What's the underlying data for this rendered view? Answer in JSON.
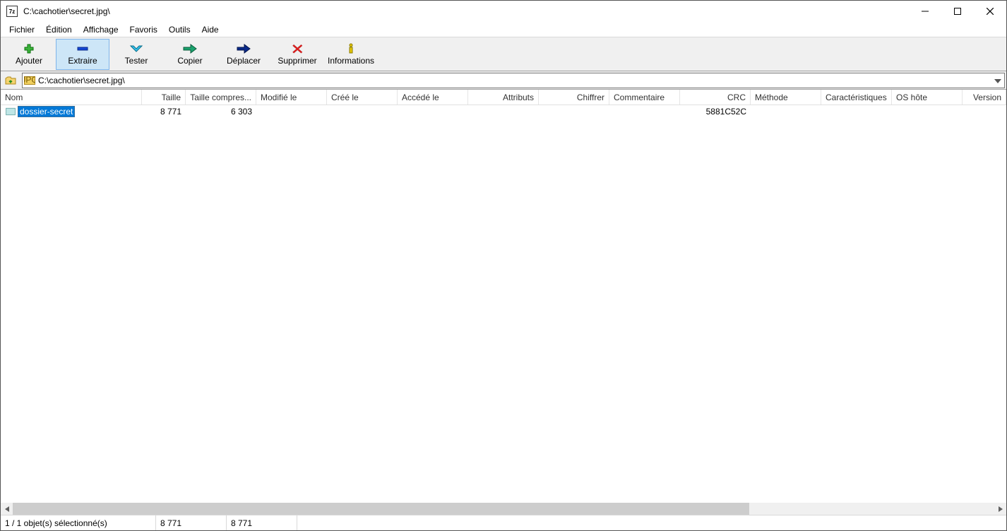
{
  "titlebar": {
    "app_badge": "7z",
    "title": "C:\\cachotier\\secret.jpg\\"
  },
  "menu": {
    "fichier": "Fichier",
    "edition": "Édition",
    "affichage": "Affichage",
    "favoris": "Favoris",
    "outils": "Outils",
    "aide": "Aide"
  },
  "toolbar": {
    "ajouter": "Ajouter",
    "extraire": "Extraire",
    "tester": "Tester",
    "copier": "Copier",
    "deplacer": "Déplacer",
    "supprimer": "Supprimer",
    "infos": "Informations"
  },
  "address": {
    "icon_label": "JPG",
    "path": "C:\\cachotier\\secret.jpg\\"
  },
  "columns": {
    "nom": "Nom",
    "taille": "Taille",
    "taille_compressee": "Taille compres...",
    "modifie": "Modifié le",
    "cree": "Créé le",
    "accede": "Accédé le",
    "attributs": "Attributs",
    "chiffrer": "Chiffrer",
    "commentaire": "Commentaire",
    "crc": "CRC",
    "methode": "Méthode",
    "carac": "Caractéristiques",
    "os": "OS hôte",
    "version": "Version"
  },
  "rows": [
    {
      "nom": "dossier-secret",
      "taille": "8 771",
      "taille_compressee": "6 303",
      "modifie": "",
      "cree": "",
      "accede": "",
      "attributs": "",
      "chiffrer": "",
      "commentaire": "",
      "crc": "5881C52C",
      "methode": "",
      "carac": "",
      "os": "",
      "version": ""
    }
  ],
  "status": {
    "selection": "1 / 1 objet(s) sélectionné(s)",
    "size1": "8 771",
    "size2": "8 771"
  }
}
